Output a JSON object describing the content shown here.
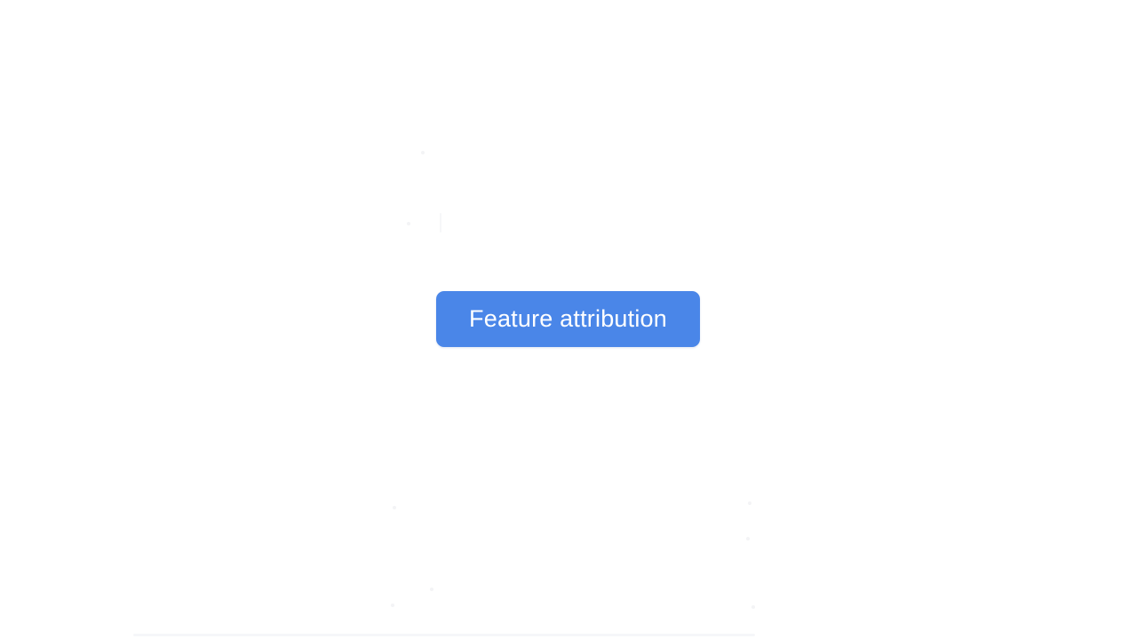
{
  "chip": {
    "label": "Feature attribution",
    "color": "#4a86e8",
    "text_color": "#ffffff"
  },
  "background_color": "#ffffff"
}
